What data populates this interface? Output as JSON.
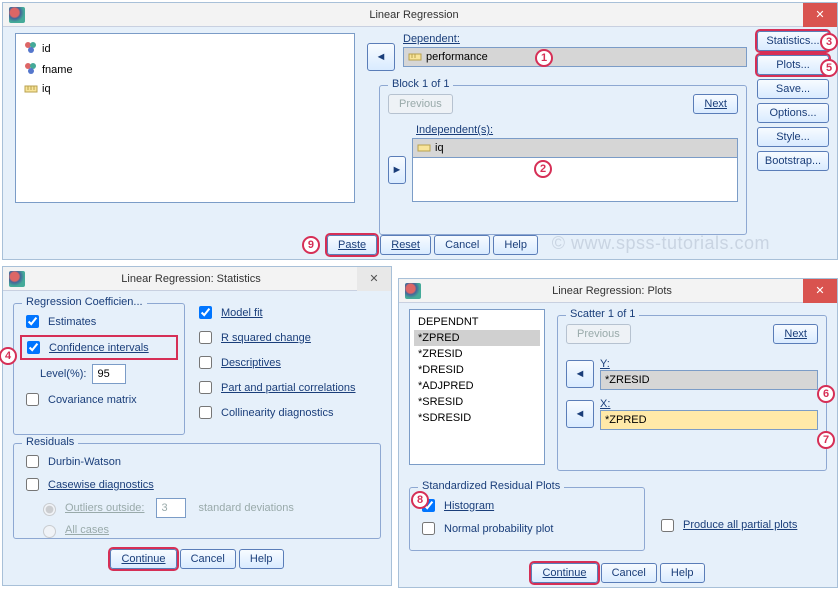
{
  "main": {
    "title": "Linear Regression",
    "close_icon": "✕",
    "vars": [
      "id",
      "fname",
      "iq"
    ],
    "dependent_label": "Dependent:",
    "dependent_value": "performance",
    "block_label": "Block 1 of 1",
    "previous": "Previous",
    "next": "Next",
    "independents_label": "Independent(s):",
    "independent_value": "iq",
    "arrow_left": "◄",
    "arrow_right": "►",
    "sidebar": [
      "Statistics...",
      "Plots...",
      "Save...",
      "Options...",
      "Style...",
      "Bootstrap..."
    ],
    "bottom": [
      "Paste",
      "Reset",
      "Cancel",
      "Help"
    ]
  },
  "stats": {
    "title": "Linear Regression: Statistics",
    "reg_legend": "Regression Coefficien...",
    "estimates": "Estimates",
    "confint": "Confidence intervals",
    "level_label": "Level(%):",
    "level_value": "95",
    "cov": "Covariance matrix",
    "modelfit": "Model fit",
    "rsq": "R squared change",
    "desc": "Descriptives",
    "part": "Part and partial correlations",
    "coll": "Collinearity diagnostics",
    "resid_legend": "Residuals",
    "durbin": "Durbin-Watson",
    "casewise": "Casewise diagnostics",
    "outliers": "Outliers outside:",
    "std": "standard deviations",
    "outliers_val": "3",
    "allcases": "All cases",
    "continue": "Continue",
    "cancel": "Cancel",
    "help": "Help"
  },
  "plots": {
    "title": "Linear Regression: Plots",
    "list": [
      "DEPENDNT",
      "*ZPRED",
      "*ZRESID",
      "*DRESID",
      "*ADJPRED",
      "*SRESID",
      "*SDRESID"
    ],
    "scatter_legend": "Scatter 1 of 1",
    "previous": "Previous",
    "next": "Next",
    "y_label": "Y:",
    "y_value": "*ZRESID",
    "x_label": "X:",
    "x_value": "*ZPRED",
    "resid_legend": "Standardized Residual Plots",
    "hist": "Histogram",
    "norm": "Normal probability plot",
    "produce": "Produce all partial plots",
    "continue": "Continue",
    "cancel": "Cancel",
    "help": "Help",
    "arrow": "◄"
  },
  "badges": {
    "b1": "1",
    "b2": "2",
    "b3": "3",
    "b4": "4",
    "b5": "5",
    "b6": "6",
    "b7": "7",
    "b8": "8",
    "b9": "9"
  },
  "watermark": "© www.spss-tutorials.com"
}
